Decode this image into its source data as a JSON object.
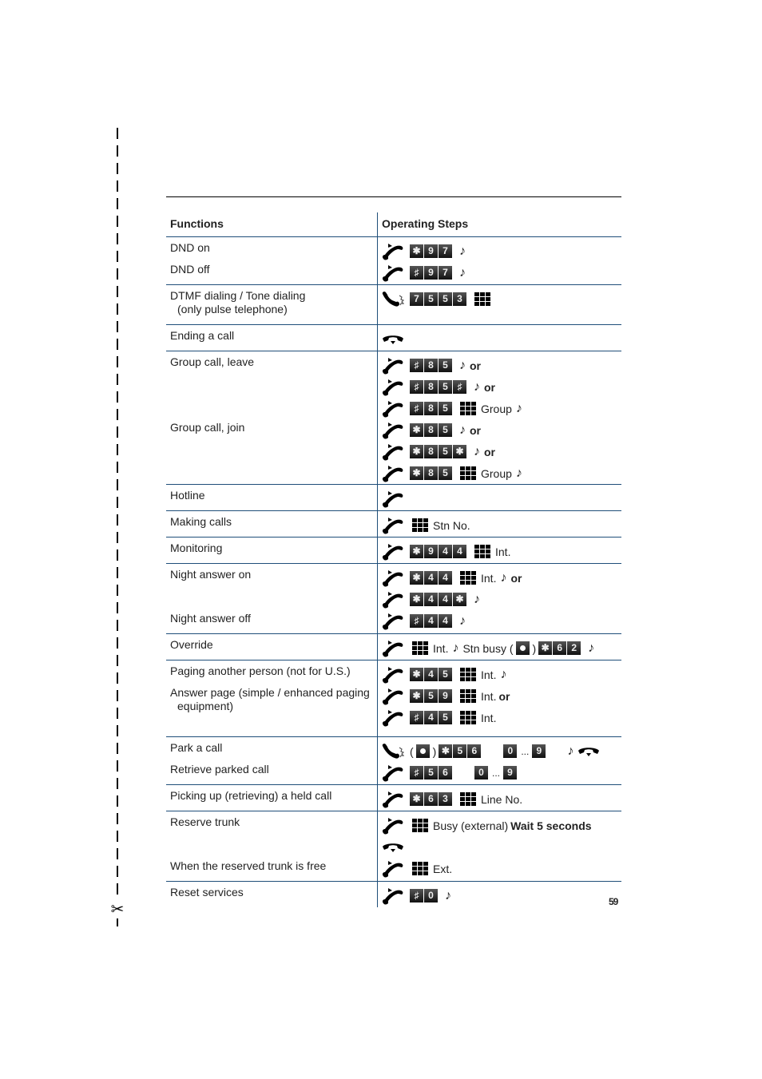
{
  "header": {
    "col_functions": "Functions",
    "col_steps": "Operating Steps"
  },
  "rows": [
    {
      "functions": [
        "DND on",
        "DND off"
      ]
    },
    {
      "functions": [
        "DTMF dialing / Tone dialing",
        "(only pulse telephone)"
      ]
    },
    {
      "functions": [
        "Ending a call"
      ]
    },
    {
      "functions": [
        "Group call, leave",
        "Group call, join"
      ]
    },
    {
      "functions": [
        "Hotline"
      ]
    },
    {
      "functions": [
        "Making calls"
      ]
    },
    {
      "functions": [
        "Monitoring"
      ]
    },
    {
      "functions": [
        "Night answer on",
        "Night answer off"
      ]
    },
    {
      "functions": [
        "Override"
      ]
    },
    {
      "functions": [
        "Paging another person  (not for U.S.)",
        "Answer page (simple / enhanced paging",
        "equipment)"
      ]
    },
    {
      "functions": [
        "Park a call",
        "Retrieve parked call"
      ]
    },
    {
      "functions": [
        "Picking up (retrieving) a held call"
      ]
    },
    {
      "functions": [
        "Reserve trunk",
        "When the reserved trunk is free"
      ]
    },
    {
      "functions": [
        "Reset services"
      ]
    }
  ],
  "words": {
    "or": "or",
    "group": "Group",
    "stn_no": "Stn No.",
    "int": "Int.",
    "int_dot": "Int.",
    "stn_busy": "Stn busy (",
    "close_paren": ")",
    "open_paren": "(",
    "line_no": "Line No.",
    "busy_external": "Busy (external)",
    "wait": "Wait 5 seconds",
    "ext": "Ext.",
    "ellipsis": "..."
  },
  "keys": {
    "star": "✱",
    "hash": "♯",
    "k0": "0",
    "k2": "2",
    "k3": "3",
    "k4": "4",
    "k5": "5",
    "k6": "6",
    "k7": "7",
    "k8": "8",
    "k9": "9"
  },
  "icons": {
    "note": "♪",
    "scissors": "✂"
  },
  "page_number": "59"
}
